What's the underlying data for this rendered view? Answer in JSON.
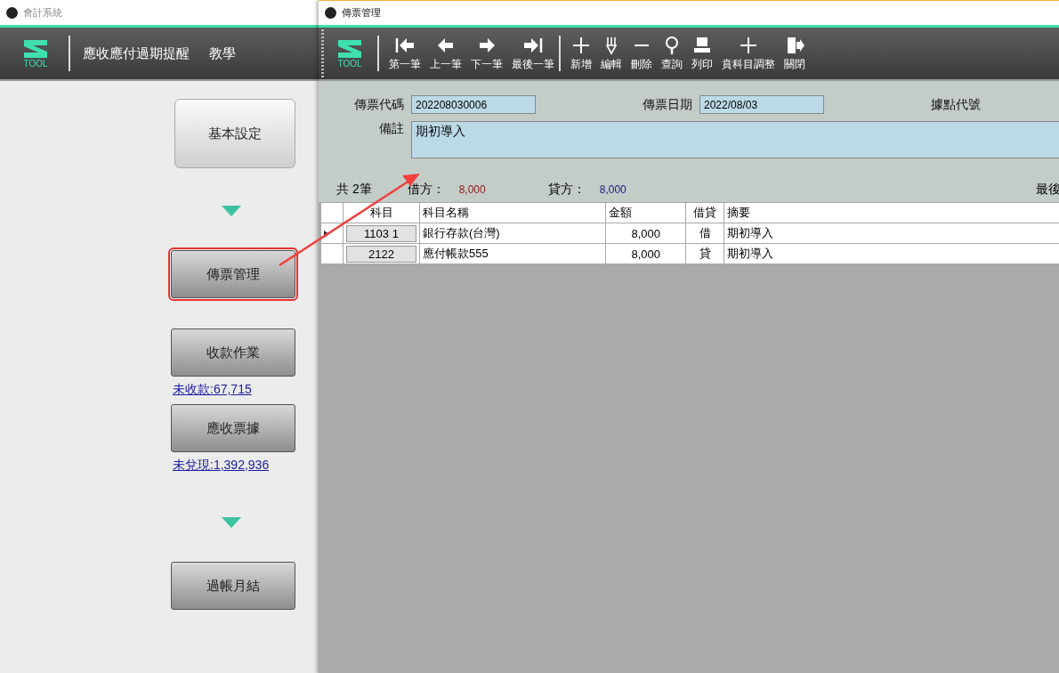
{
  "left_window": {
    "title": "會計系統",
    "logo_text": "TOOL",
    "menu": [
      {
        "label": "應收應付過期提醒"
      },
      {
        "label": "教學"
      }
    ],
    "steps": [
      {
        "kind": "main",
        "label": "基本設定",
        "highlighted": false
      },
      {
        "kind": "down"
      },
      {
        "kind": "button",
        "label": "傳票管理",
        "highlighted": true
      },
      {
        "kind": "button",
        "label": "收款作業",
        "highlighted": false,
        "note": "未收款:67,715"
      },
      {
        "kind": "button",
        "label": "應收票據",
        "highlighted": false,
        "note": "未兌現:1,392,936"
      },
      {
        "kind": "down"
      },
      {
        "kind": "button",
        "label": "過帳月結",
        "highlighted": false
      }
    ]
  },
  "voucher_window": {
    "title": "傳票管理",
    "logo_text": "TOOL",
    "nav": [
      {
        "kind": "first",
        "label": "第一筆"
      },
      {
        "kind": "prev",
        "label": "上一筆"
      },
      {
        "kind": "next",
        "label": "下一筆"
      },
      {
        "kind": "last",
        "label": "最後一筆"
      }
    ],
    "actions": [
      {
        "kind": "plus",
        "label": "新增"
      },
      {
        "kind": "pen",
        "label": "編輯"
      },
      {
        "kind": "minus",
        "label": "刪除"
      },
      {
        "kind": "search",
        "label": "查詢"
      },
      {
        "kind": "print",
        "label": "列印"
      },
      {
        "kind": "plus",
        "label": "賁科目調整"
      },
      {
        "kind": "exit",
        "label": "關閉"
      }
    ],
    "fields": [
      {
        "label": "傳票代碼",
        "value": "202208030006"
      },
      {
        "label": "傳票日期",
        "value": "2022/08/03"
      },
      {
        "label": "據點代號"
      }
    ],
    "remark": {
      "label": "備註",
      "value": "期初導入"
    },
    "summary": {
      "count": "共 2筆",
      "debit_label": "借方：",
      "debit": "8,000",
      "credit_label": "貸方：",
      "credit": "8,000",
      "last": "最後"
    },
    "columns": [
      "科目",
      "科目名稱",
      "金額",
      "借貸",
      "摘要"
    ],
    "rows": [
      {
        "current": true,
        "cells": [
          "1103  1",
          "銀行存款(台灣)",
          "8,000",
          "借",
          "期初導入"
        ]
      },
      {
        "current": false,
        "cells": [
          "2122",
          "應付帳款555",
          "8,000",
          "貸",
          "期初導入"
        ]
      }
    ]
  }
}
